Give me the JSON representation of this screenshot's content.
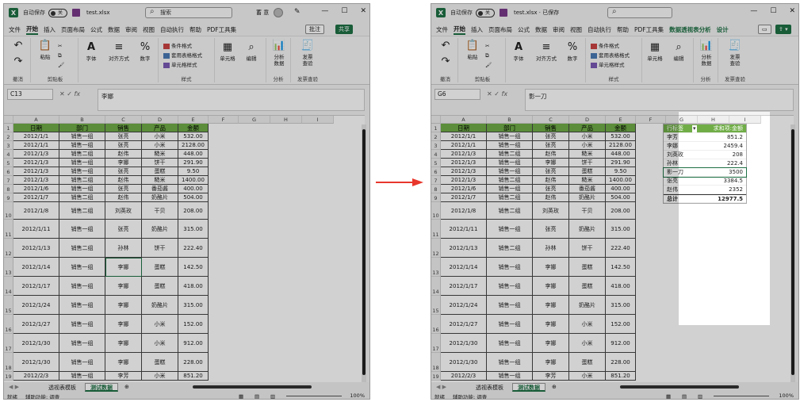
{
  "left": {
    "autosave_label": "自动保存",
    "autosave_state": "关",
    "filename": "test.xlsx",
    "search_placeholder": "搜索",
    "username": "蓄 意",
    "menu": [
      "文件",
      "开始",
      "插入",
      "页面布局",
      "公式",
      "数据",
      "审阅",
      "视图",
      "自动执行",
      "帮助",
      "PDF工具集"
    ],
    "comment_btn": "批注",
    "share_btn": "共享",
    "namebox": "C13",
    "formula": "李娜",
    "ribbon": {
      "undo_label": "撤消",
      "clipboard_label": "剪贴板",
      "paste": "粘贴",
      "font": "字体",
      "align": "对齐方式",
      "number": "数字",
      "styles_label": "样式",
      "cond_fmt": "条件格式",
      "table_fmt": "套用表格格式",
      "cell_style": "单元格样式",
      "cells": "单元格",
      "edit": "编辑",
      "analyze": "分析\n数据",
      "analyze_label": "分析",
      "invoice": "发票\n查验",
      "invoice_label": "发票查验"
    },
    "sheets": [
      "透视表模板",
      "测试数据"
    ],
    "status": "就绪",
    "accessibility": "辅助功能: 调查",
    "zoom": "100%"
  },
  "right": {
    "autosave_label": "自动保存",
    "autosave_state": "关",
    "filename": "test.xlsx · 已保存",
    "search_placeholder": "",
    "menu": [
      "文件",
      "开始",
      "插入",
      "页面布局",
      "公式",
      "数据",
      "审阅",
      "视图",
      "自动执行",
      "帮助",
      "PDF工具集",
      "数据透视表分析",
      "设计"
    ],
    "namebox": "G6",
    "formula": "影一刀",
    "sheets": [
      "透视表模板",
      "测试数据"
    ],
    "status": "就绪",
    "accessibility": "辅助功能: 调查",
    "zoom": "100%"
  },
  "columns": [
    "A",
    "B",
    "C",
    "D",
    "E",
    "F",
    "G",
    "H",
    "I"
  ],
  "table_headers": [
    "日期",
    "部门",
    "销售",
    "产品",
    "金额"
  ],
  "rows": [
    [
      "2012/1/1",
      "销售一组",
      "张亮",
      "小米",
      "532.00"
    ],
    [
      "2012/1/1",
      "销售一组",
      "张亮",
      "小米",
      "2128.00"
    ],
    [
      "2012/1/3",
      "销售二组",
      "赵伟",
      "糙米",
      "448.00"
    ],
    [
      "2012/1/3",
      "销售一组",
      "李娜",
      "饼干",
      "291.90"
    ],
    [
      "2012/1/3",
      "销售一组",
      "张亮",
      "蛋糕",
      "9.50"
    ],
    [
      "2012/1/3",
      "销售二组",
      "赵伟",
      "糙米",
      "1400.00"
    ],
    [
      "2012/1/6",
      "销售一组",
      "张亮",
      "番茄酱",
      "400.00"
    ],
    [
      "2012/1/7",
      "销售二组",
      "赵伟",
      "奶酪片",
      "504.00"
    ],
    [
      "2012/1/8",
      "销售二组",
      "刘英玫",
      "干贝",
      "208.00"
    ],
    [
      "2012/1/11",
      "销售一组",
      "张亮",
      "奶酪片",
      "315.00"
    ],
    [
      "2012/1/13",
      "销售二组",
      "孙林",
      "饼干",
      "222.40"
    ],
    [
      "2012/1/14",
      "销售一组",
      "李娜",
      "蛋糕",
      "142.50"
    ],
    [
      "2012/1/17",
      "销售一组",
      "李娜",
      "蛋糕",
      "418.00"
    ],
    [
      "2012/1/24",
      "销售一组",
      "李娜",
      "奶酪片",
      "315.00"
    ],
    [
      "2012/1/27",
      "销售一组",
      "李娜",
      "小米",
      "152.00"
    ],
    [
      "2012/1/30",
      "销售一组",
      "李娜",
      "小米",
      "912.00"
    ],
    [
      "2012/1/30",
      "销售一组",
      "李娜",
      "蛋糕",
      "228.00"
    ],
    [
      "2012/2/3",
      "销售一组",
      "李芳",
      "小米",
      "851.20"
    ]
  ],
  "pivot": {
    "header_label": "行标签",
    "header_value": "求和项:金额",
    "items": [
      [
        "李芳",
        "851.2"
      ],
      [
        "李娜",
        "2459.4"
      ],
      [
        "刘英玫",
        "208"
      ],
      [
        "孙林",
        "222.4"
      ],
      [
        "影一刀",
        "3500"
      ],
      [
        "张亮",
        "3384.5"
      ],
      [
        "赵伟",
        "2352"
      ]
    ],
    "total_label": "总计",
    "total_value": "12977.5"
  }
}
